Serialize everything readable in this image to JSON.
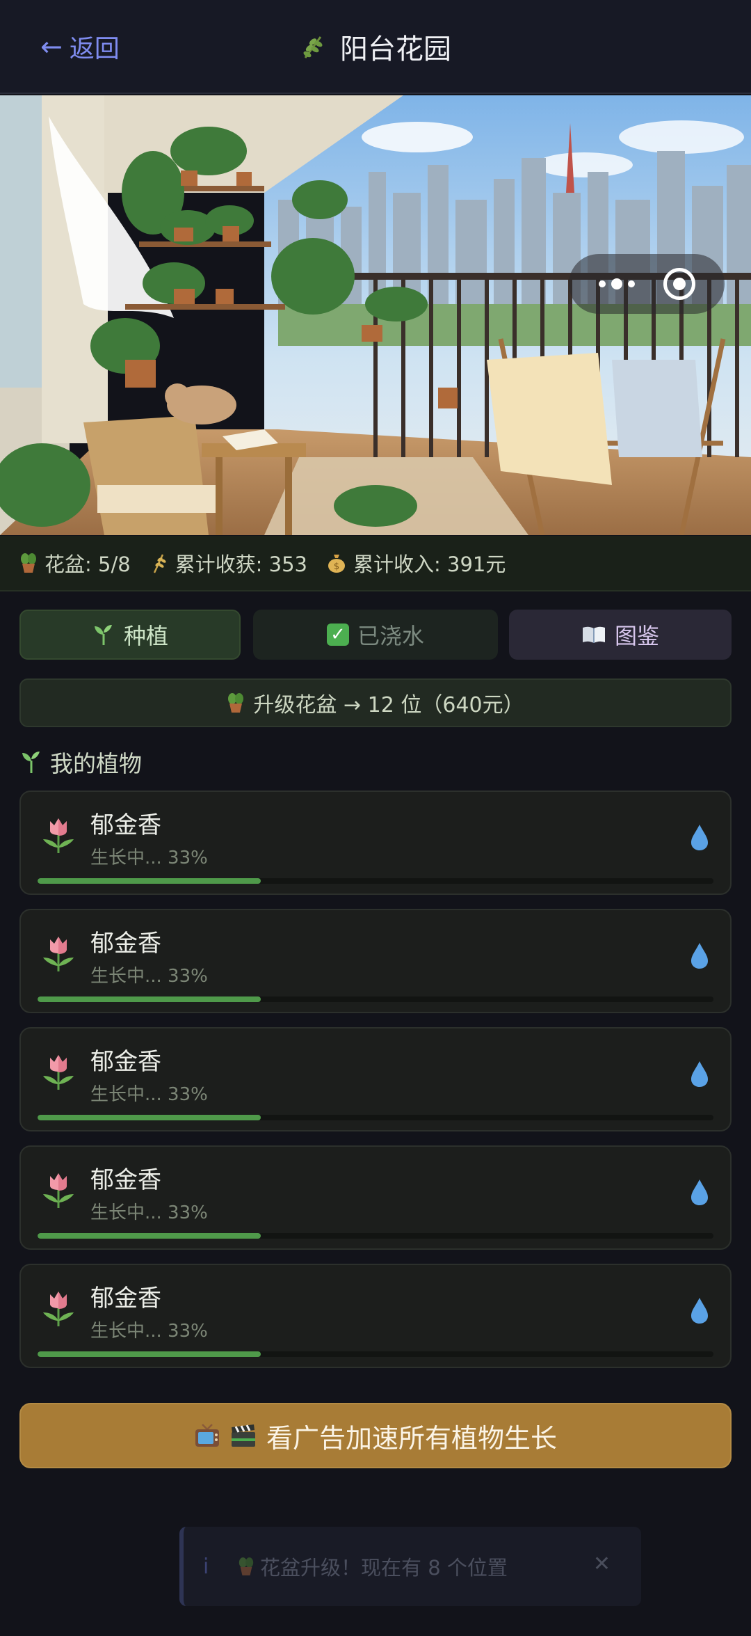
{
  "header": {
    "back_label": "返回",
    "back_arrow": "←",
    "title": "阳台花园",
    "title_icon": "herb-icon"
  },
  "hero": {
    "description_icon": "balcony-illustration",
    "capsule": {
      "menu_icon": "more-dots-icon",
      "close_icon": "target-close-icon"
    }
  },
  "stats": {
    "pots": "花盆: 5/8",
    "harvest": "累计收获: 353",
    "income": "累计收入: 391元"
  },
  "actions": {
    "plant_label": "种植",
    "water_label": "已浇水",
    "guide_label": "图鉴"
  },
  "upgrade": {
    "label": "升级花盆 → 12 位（640元）"
  },
  "section": {
    "title": "我的植物"
  },
  "plants": [
    {
      "name": "郁金香",
      "status": "生长中... 33%",
      "progress": 0.33
    },
    {
      "name": "郁金香",
      "status": "生长中... 33%",
      "progress": 0.33
    },
    {
      "name": "郁金香",
      "status": "生长中... 33%",
      "progress": 0.33
    },
    {
      "name": "郁金香",
      "status": "生长中... 33%",
      "progress": 0.33
    },
    {
      "name": "郁金香",
      "status": "生长中... 33%",
      "progress": 0.33
    }
  ],
  "ad": {
    "label": "看广告加速所有植物生长"
  },
  "toast": {
    "message": "花盆升级！现在有 8 个位置",
    "info_icon": "i",
    "close": "✕"
  },
  "colors": {
    "accent_blue": "#7f8cf0",
    "progress_green": "#4f9a4a",
    "ad_gold": "#a87c36",
    "background": "#12131a"
  }
}
